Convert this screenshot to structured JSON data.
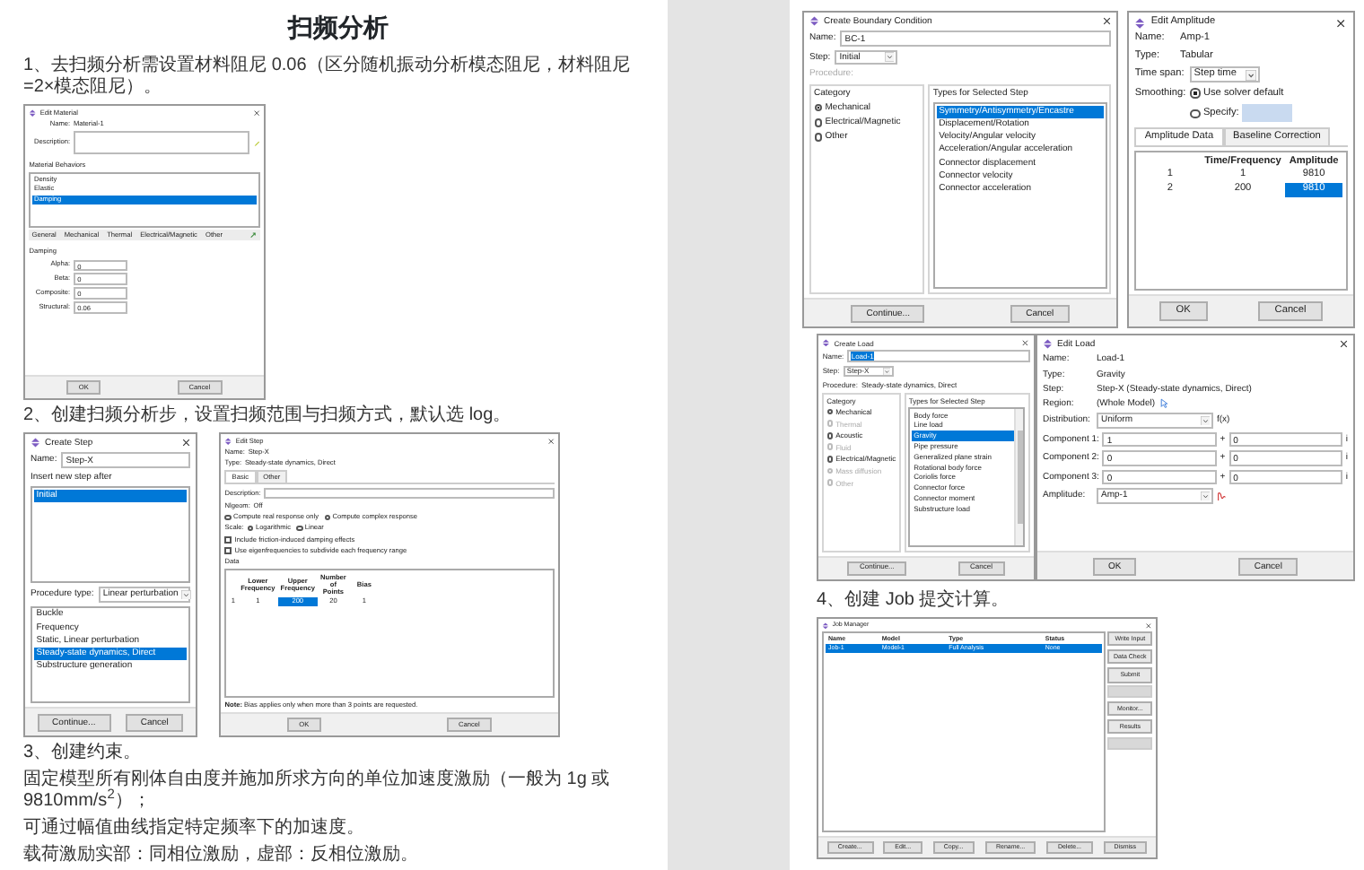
{
  "pages": [
    {
      "blocks": [
        {
          "kind": "title",
          "text": "扫频分析"
        },
        {
          "kind": "paragraph",
          "text": "1、去扫频分析需设置材料阻尼 0.06（区分随机振动分析模态阻尼，材料阻尼=2×模态阻尼）。"
        },
        {
          "kind": "figure",
          "dialogs": [
            {
              "title": "Edit Material",
              "widgets": [
                {
                  "kind": "info",
                  "label": "Name:",
                  "value": "Material-1"
                },
                {
                  "kind": "edit-field",
                  "label": "Description:"
                },
                {
                  "kind": "label",
                  "text": "Material Behaviors",
                  "disabled": false
                },
                {
                  "kind": "list",
                  "items": [
                    {
                      "label": "Density",
                      "selected": false
                    },
                    {
                      "label": "Elastic",
                      "selected": false
                    },
                    {
                      "label": "Damping",
                      "selected": true
                    }
                  ]
                },
                {
                  "kind": "menubar",
                  "items": [
                    "General",
                    "Mechanical",
                    "Thermal",
                    "Electrical/Magnetic",
                    "Other"
                  ]
                },
                {
                  "kind": "label",
                  "text": "Damping",
                  "disabled": false
                },
                {
                  "kind": "field",
                  "label": "Alpha:",
                  "value": "0"
                },
                {
                  "kind": "field",
                  "label": "Beta:",
                  "value": "0"
                },
                {
                  "kind": "field",
                  "label": "Composite:",
                  "value": "0"
                },
                {
                  "kind": "field",
                  "label": "Structural:",
                  "value": "0.06"
                }
              ],
              "buttons": [
                "OK",
                "Cancel"
              ]
            }
          ]
        },
        {
          "kind": "paragraph",
          "text": "2、创建扫频分析步，设置扫频范围与扫频方式，默认选 log。"
        },
        {
          "kind": "figure",
          "dialogs": [
            {
              "title": "Create Step",
              "widgets": [
                {
                  "kind": "field",
                  "label": "Name:",
                  "value": "Step-X"
                },
                {
                  "kind": "label",
                  "text": "Insert new step after",
                  "disabled": false
                },
                {
                  "kind": "list",
                  "items": [
                    {
                      "label": "Initial",
                      "selected": true
                    }
                  ]
                },
                {
                  "kind": "select",
                  "label": "Procedure type:",
                  "value": "Linear perturbation"
                },
                {
                  "kind": "list",
                  "items": [
                    {
                      "label": "Buckle",
                      "selected": false
                    },
                    {
                      "label": "Frequency",
                      "selected": false
                    },
                    {
                      "label": "Static, Linear perturbation",
                      "selected": false
                    },
                    {
                      "label": "Steady-state dynamics, Direct",
                      "selected": true
                    },
                    {
                      "label": "Substructure generation",
                      "selected": false
                    }
                  ]
                }
              ],
              "buttons": [
                "Continue...",
                "Cancel"
              ]
            },
            {
              "title": "Edit Step",
              "widgets": [
                {
                  "kind": "info",
                  "label": "Name:",
                  "value": "Step-X"
                },
                {
                  "kind": "info",
                  "label": "Type:",
                  "value": "Steady-state dynamics, Direct"
                },
                {
                  "kind": "tabs",
                  "items": [
                    {
                      "label": "Basic",
                      "selected": true
                    },
                    {
                      "label": "Other",
                      "selected": false
                    }
                  ]
                },
                {
                  "kind": "field",
                  "label": "Description:"
                },
                {
                  "kind": "info",
                  "label": "Nlgeom:",
                  "value": "Off"
                },
                {
                  "kind": "radios",
                  "items": [
                    {
                      "label": "Compute real response only",
                      "selected": false,
                      "disabled": false
                    },
                    {
                      "label": "Compute complex response",
                      "selected": true,
                      "disabled": false
                    }
                  ]
                },
                {
                  "kind": "radios",
                  "label": "Scale:",
                  "items": [
                    {
                      "label": "Logarithmic",
                      "selected": true,
                      "disabled": false
                    },
                    {
                      "label": "Linear",
                      "selected": false,
                      "disabled": false
                    }
                  ]
                },
                {
                  "kind": "checkbox",
                  "label": "Include friction-induced damping effects",
                  "checked": false
                },
                {
                  "kind": "checkbox",
                  "label": "Use eigenfrequencies to subdivide each frequency range",
                  "checked": false
                },
                {
                  "kind": "label",
                  "text": "Data",
                  "disabled": false
                },
                {
                  "kind": "table",
                  "columns": [
                    "Lower Frequency",
                    "Upper Frequency",
                    "Number of Points",
                    "Bias"
                  ],
                  "rows": [
                    {
                      "label": "1",
                      "cells": [
                        {
                          "text": "1",
                          "selected": false
                        },
                        {
                          "text": "200",
                          "selected": true
                        },
                        {
                          "text": "20",
                          "selected": false
                        },
                        {
                          "text": "1",
                          "selected": false
                        }
                      ]
                    }
                  ]
                },
                {
                  "kind": "note",
                  "text": "**Note:** Bias applies only when more than 3 points are requested."
                }
              ],
              "buttons": [
                "OK",
                "Cancel"
              ]
            }
          ]
        },
        {
          "kind": "paragraph",
          "text": "3、创建约束。"
        },
        {
          "kind": "paragraph",
          "text": "固定模型所有刚体自由度并施加所求方向的单位加速度激励（一般为 1g 或 9810mm/s$^{2}$）；"
        },
        {
          "kind": "paragraph",
          "text": "可通过幅值曲线指定特定频率下的加速度。"
        },
        {
          "kind": "paragraph",
          "text": "载荷激励实部：同相位激励，虚部：反相位激励。"
        }
      ]
    },
    {
      "blocks": [
        {
          "kind": "figure",
          "dialogs": [
            {
              "title": "Create Boundary Condition",
              "widgets": [
                {
                  "kind": "field",
                  "label": "Name:",
                  "value": "BC-1"
                },
                {
                  "kind": "select",
                  "label": "Step:",
                  "value": "Initial"
                },
                {
                  "kind": "label",
                  "text": "Procedure:",
                  "disabled": true
                },
                {
                  "kind": "columns",
                  "columns": [
                    {
                      "widgets": [
                        {
                          "kind": "group",
                          "title": "Category",
                          "widgets": [
                            {
                              "kind": "radios",
                              "items": [
                                {
                                  "label": "Mechanical",
                                  "selected": true,
                                  "disabled": false
                                },
                                {
                                  "label": "Electrical/Magnetic",
                                  "selected": false,
                                  "disabled": false
                                },
                                {
                                  "label": "Other",
                                  "selected": false,
                                  "disabled": false
                                }
                              ]
                            }
                          ]
                        }
                      ]
                    },
                    {
                      "widgets": [
                        {
                          "kind": "group",
                          "title": "Types for Selected Step",
                          "widgets": [
                            {
                              "kind": "list",
                              "items": [
                                {
                                  "label": "Symmetry/Antisymmetry/Encastre",
                                  "selected": true
                                },
                                {
                                  "label": "Displacement/Rotation",
                                  "selected": false
                                },
                                {
                                  "label": "Velocity/Angular velocity",
                                  "selected": false
                                },
                                {
                                  "label": "Acceleration/Angular acceleration",
                                  "selected": false
                                },
                                {
                                  "label": "Connector displacement",
                                  "selected": false
                                },
                                {
                                  "label": "Connector velocity",
                                  "selected": false
                                },
                                {
                                  "label": "Connector acceleration",
                                  "selected": false
                                }
                              ]
                            }
                          ]
                        }
                      ]
                    }
                  ]
                }
              ],
              "buttons": [
                "Continue...",
                "Cancel"
              ]
            },
            {
              "title": "Edit Amplitude",
              "widgets": [
                {
                  "kind": "info",
                  "label": "Name:",
                  "value": "Amp-1"
                },
                {
                  "kind": "info",
                  "label": "Type:",
                  "value": "Tabular"
                },
                {
                  "kind": "select",
                  "label": "Time span:",
                  "value": "Step time"
                },
                {
                  "kind": "radios",
                  "label": "Smoothing:",
                  "items": [
                    {
                      "label": "Use solver default",
                      "selected": true,
                      "disabled": false
                    },
                    {
                      "label": "Specify:",
                      "selected": false,
                      "disabled": false,
                      "input": true
                    }
                  ]
                },
                {
                  "kind": "tabs",
                  "items": [
                    {
                      "label": "Amplitude Data",
                      "selected": true
                    },
                    {
                      "label": "Baseline Correction",
                      "selected": false
                    }
                  ]
                },
                {
                  "kind": "table",
                  "columns": [
                    "Time/Frequency",
                    "Amplitude"
                  ],
                  "rows": [
                    {
                      "label": "1",
                      "cells": [
                        {
                          "text": "1",
                          "selected": false
                        },
                        {
                          "text": "9810",
                          "selected": false
                        }
                      ]
                    },
                    {
                      "label": "2",
                      "cells": [
                        {
                          "text": "200",
                          "selected": false
                        },
                        {
                          "text": "9810",
                          "selected": true
                        }
                      ]
                    }
                  ]
                }
              ],
              "buttons": [
                "OK",
                "Cancel"
              ]
            }
          ]
        },
        {
          "kind": "figure",
          "dialogs": [
            {
              "title": "Create Load",
              "widgets": [
                {
                  "kind": "field",
                  "label": "Name:",
                  "value": "Load-1",
                  "highlighted": true
                },
                {
                  "kind": "select",
                  "label": "Step:",
                  "value": "Step-X"
                },
                {
                  "kind": "info",
                  "label": "Procedure:",
                  "value": "Steady-state dynamics, Direct"
                },
                {
                  "kind": "columns",
                  "columns": [
                    {
                      "widgets": [
                        {
                          "kind": "group",
                          "title": "Category",
                          "widgets": [
                            {
                              "kind": "radios",
                              "items": [
                                {
                                  "label": "Mechanical",
                                  "selected": true,
                                  "disabled": false
                                },
                                {
                                  "label": "Thermal",
                                  "selected": false,
                                  "disabled": true
                                },
                                {
                                  "label": "Acoustic",
                                  "selected": false,
                                  "disabled": false
                                },
                                {
                                  "label": "Fluid",
                                  "selected": false,
                                  "disabled": true
                                },
                                {
                                  "label": "Electrical/Magnetic",
                                  "selected": false,
                                  "disabled": false
                                },
                                {
                                  "label": "Mass diffusion",
                                  "selected": false,
                                  "disabled": true
                                },
                                {
                                  "label": "Other",
                                  "selected": false,
                                  "disabled": true
                                }
                              ]
                            }
                          ]
                        }
                      ]
                    },
                    {
                      "widgets": [
                        {
                          "kind": "group",
                          "title": "Types for Selected Step",
                          "widgets": [
                            {
                              "kind": "list",
                              "scroll": true,
                              "items": [
                                {
                                  "label": "Body force",
                                  "selected": false
                                },
                                {
                                  "label": "Line load",
                                  "selected": false
                                },
                                {
                                  "label": "Gravity",
                                  "selected": true
                                },
                                {
                                  "label": "Pipe pressure",
                                  "selected": false
                                },
                                {
                                  "label": "Generalized plane strain",
                                  "selected": false
                                },
                                {
                                  "label": "Rotational body force",
                                  "selected": false
                                },
                                {
                                  "label": "Coriolis force",
                                  "selected": false
                                },
                                {
                                  "label": "Connector force",
                                  "selected": false
                                },
                                {
                                  "label": "Connector moment",
                                  "selected": false
                                },
                                {
                                  "label": "Substructure load",
                                  "selected": false
                                }
                              ]
                            }
                          ]
                        }
                      ]
                    }
                  ]
                }
              ],
              "buttons": [
                "Continue...",
                "Cancel"
              ]
            },
            {
              "title": "Edit Load",
              "widgets": [
                {
                  "kind": "info",
                  "label": "Name:",
                  "value": "Load-1"
                },
                {
                  "kind": "info",
                  "label": "Type:",
                  "value": "Gravity"
                },
                {
                  "kind": "info",
                  "label": "Step:",
                  "value": "Step-X (Steady-state dynamics, Direct)"
                },
                {
                  "kind": "region-info",
                  "label": "Region:",
                  "value": "(Whole Model)"
                },
                {
                  "kind": "select",
                  "label": "Distribution:",
                  "value": "Uniform",
                  "suffix": "f(x)"
                },
                {
                  "kind": "complex",
                  "label": "Component 1:",
                  "value": "1",
                  "sep": "+",
                  "imag": "0",
                  "unit": "i"
                },
                {
                  "kind": "complex",
                  "label": "Component 2:",
                  "value": "0",
                  "sep": "+",
                  "imag": "0",
                  "unit": "i"
                },
                {
                  "kind": "complex",
                  "label": "Component 3:",
                  "value": "0",
                  "sep": "+",
                  "imag": "0",
                  "unit": "i"
                },
                {
                  "kind": "amplitude-select",
                  "label": "Amplitude:",
                  "value": "Amp-1"
                }
              ],
              "buttons": [
                "OK",
                "Cancel"
              ]
            }
          ]
        },
        {
          "kind": "paragraph",
          "text": "4、创建 Job 提交计算。"
        },
        {
          "kind": "figure",
          "dialogs": [
            {
              "title": "Job Manager",
              "widgets": [
                {
                  "kind": "columns",
                  "columns": [
                    {
                      "widgets": [
                        {
                          "kind": "table",
                          "columns": [
                            "Name",
                            "Model",
                            "Type",
                            "Status"
                          ],
                          "rows": [
                            {
                              "cells": [
                                {
                                  "text": "Job-1",
                                  "selected": true
                                },
                                {
                                  "text": "Model-1",
                                  "selected": true
                                },
                                {
                                  "text": "Full Analysis",
                                  "selected": true
                                },
                                {
                                  "text": "None",
                                  "selected": true
                                }
                              ]
                            }
                          ]
                        }
                      ]
                    },
                    {
                      "widgets": [
                        {
                          "kind": "button-column",
                          "items": [
                            {
                              "label": "Write Input",
                              "disabled": false
                            },
                            {
                              "label": "Data Check",
                              "disabled": false
                            },
                            {
                              "label": "Submit",
                              "disabled": false
                            },
                            {
                              "disabled": true
                            },
                            {
                              "label": "Monitor...",
                              "disabled": false
                            },
                            {
                              "label": "Results",
                              "disabled": false
                            },
                            {
                              "disabled": true
                            }
                          ]
                        }
                      ]
                    }
                  ]
                }
              ],
              "buttons": [
                "Create...",
                "Edit...",
                "Copy...",
                "Rename...",
                "Delete...",
                "Dismiss"
              ]
            }
          ]
        }
      ]
    }
  ]
}
